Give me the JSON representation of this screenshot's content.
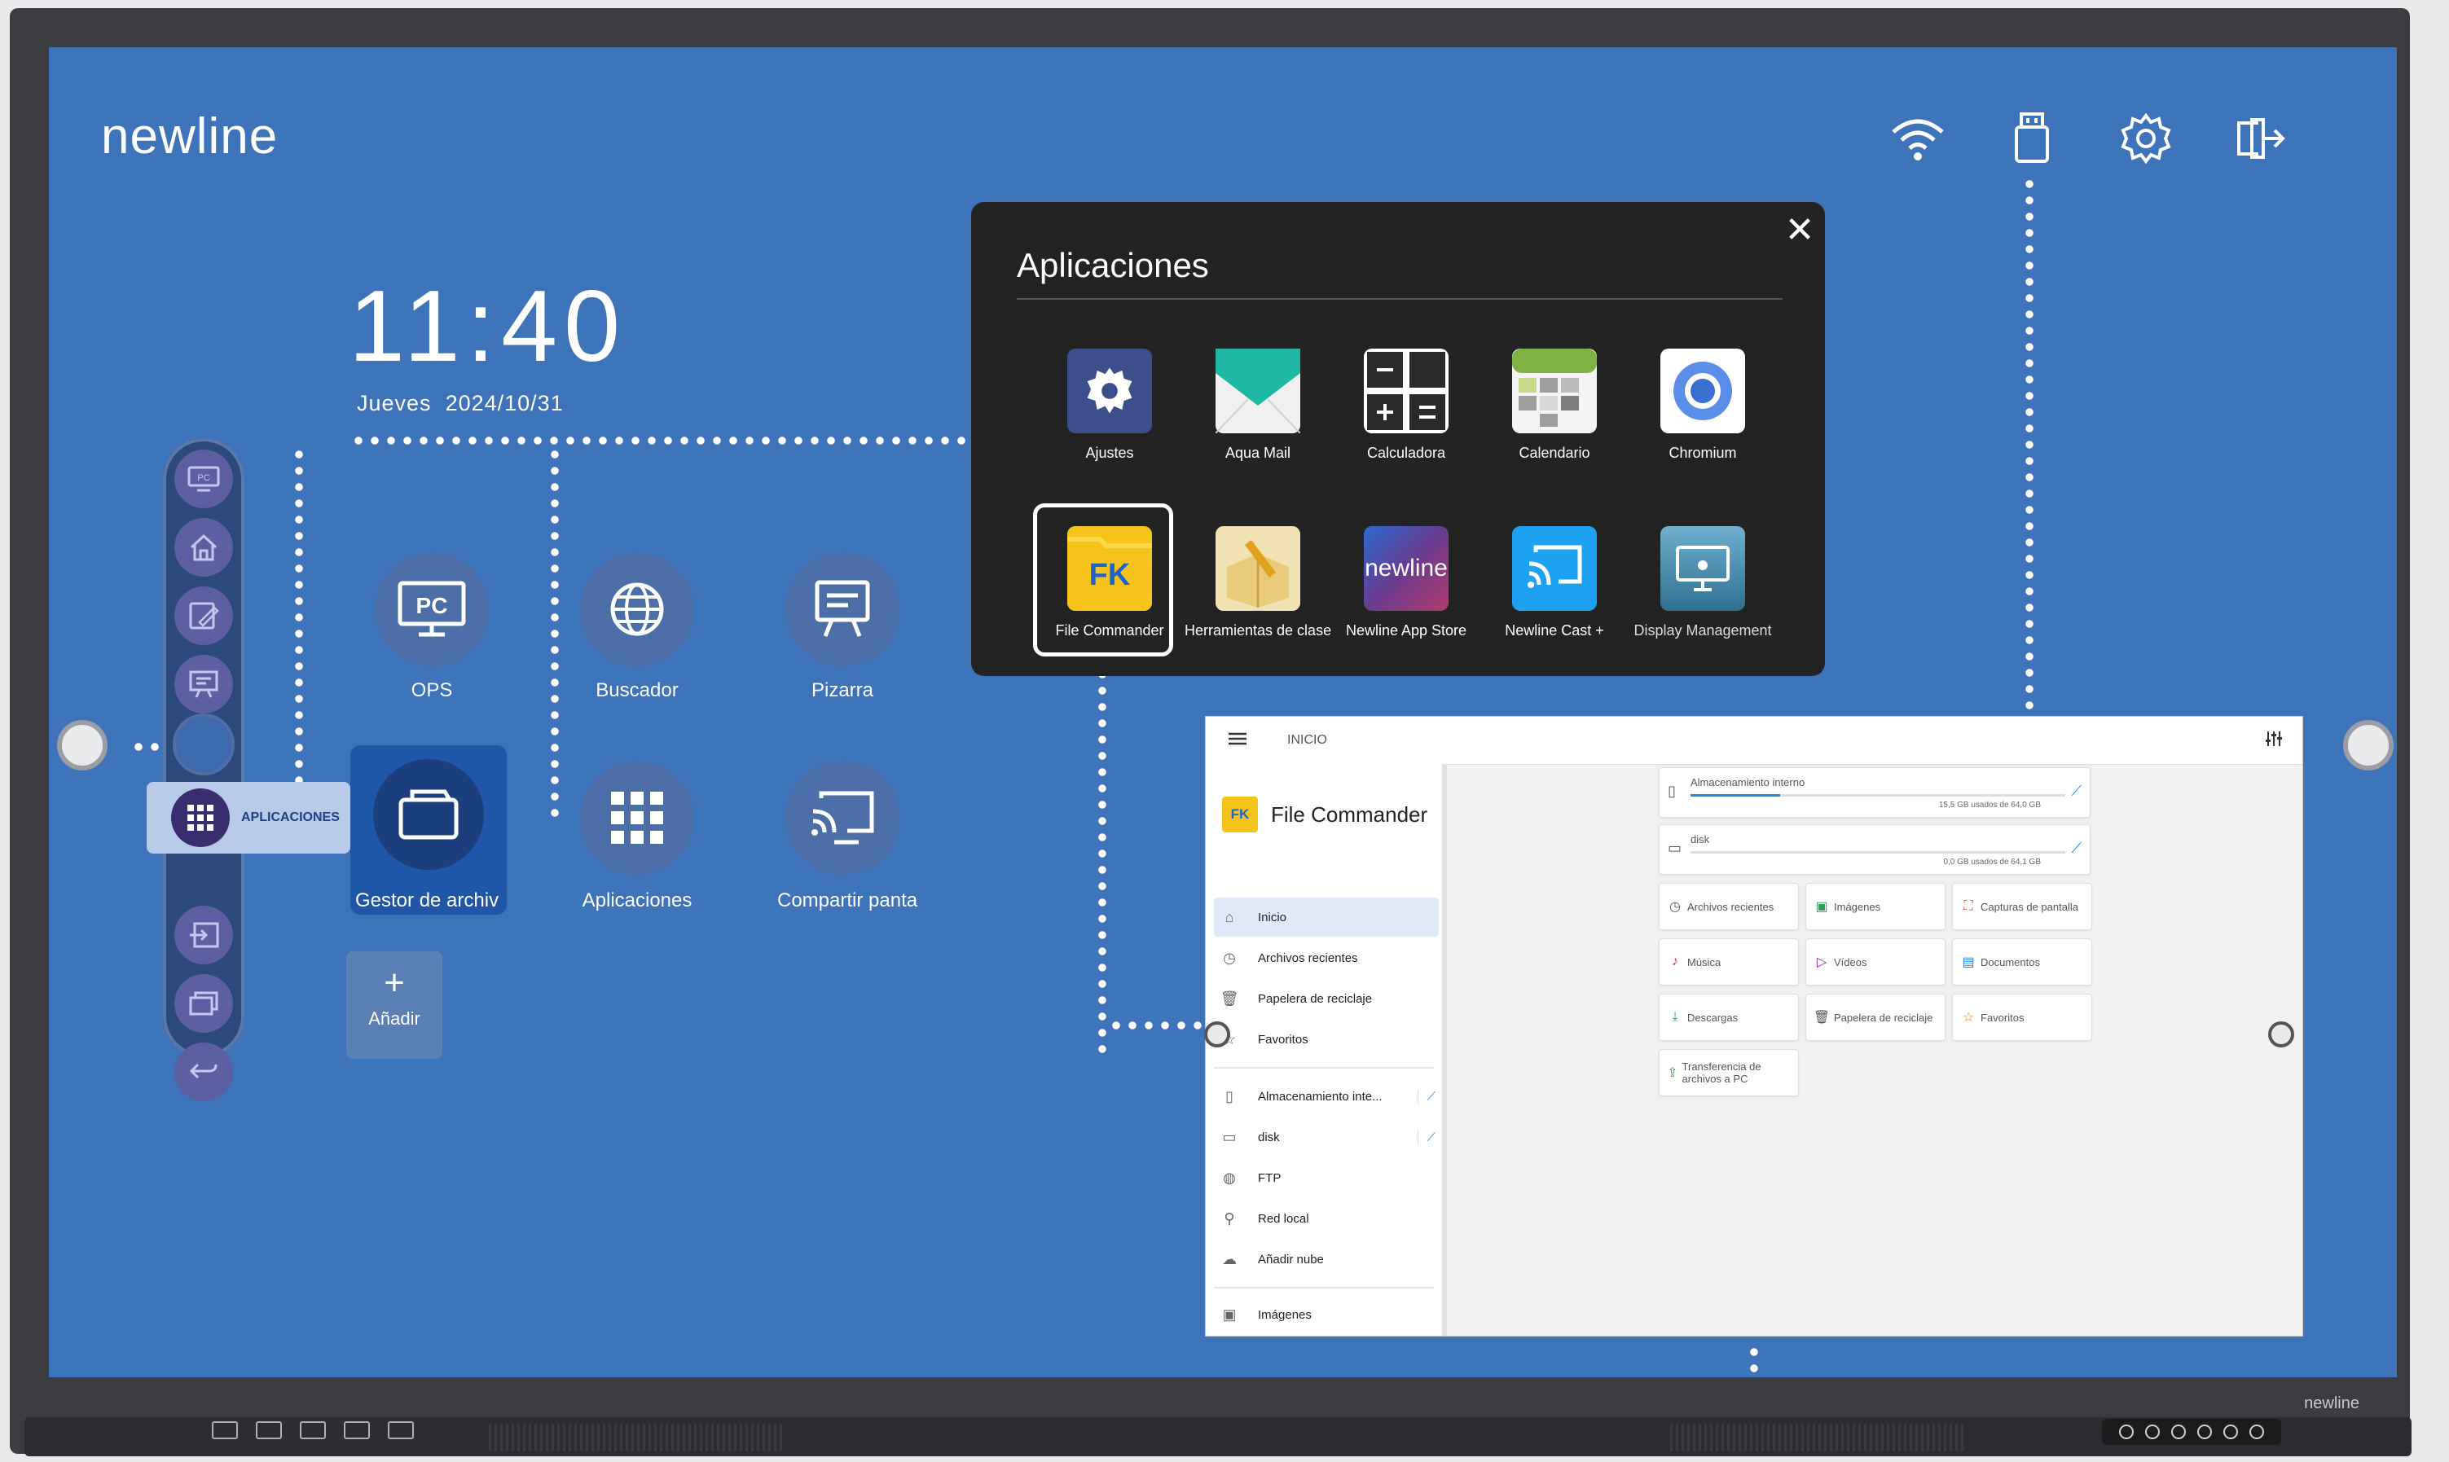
{
  "brand": {
    "logo": "newline",
    "bezel_label": "newline"
  },
  "status_icons": [
    "wifi-icon",
    "usb-icon",
    "gear-icon",
    "input-source-icon"
  ],
  "clock": {
    "time": "11:40",
    "day": "Jueves",
    "date": "2024/10/31"
  },
  "sidebar": {
    "items": [
      "pc-icon",
      "home-icon",
      "whiteboard-edit-icon",
      "presentation-icon",
      "ring-indicator",
      "apps-icon",
      "input-icon",
      "windows-icon",
      "back-icon"
    ],
    "active_label": "APLICACIONES"
  },
  "home_tiles": [
    {
      "label": "OPS",
      "icon": "pc-icon"
    },
    {
      "label": "Buscador",
      "icon": "globe-icon"
    },
    {
      "label": "Pizarra",
      "icon": "whiteboard-icon"
    },
    {
      "label": "Gestor de archiv",
      "icon": "folder-icon"
    },
    {
      "label": "Aplicaciones",
      "icon": "apps-grid-icon"
    },
    {
      "label": "Compartir panta",
      "icon": "screen-share-icon"
    }
  ],
  "add_button": {
    "symbol": "+",
    "label": "Añadir"
  },
  "apps_panel": {
    "title": "Aplicaciones",
    "close_symbol": "✕",
    "apps": [
      {
        "label": "Ajustes",
        "icon": "settings-gear-icon",
        "color": "#3c4f8a"
      },
      {
        "label": "Aqua Mail",
        "icon": "mail-envelope-icon",
        "color": "#1fb8a6"
      },
      {
        "label": "Calculadora",
        "icon": "calculator-icon",
        "color": "#2a2a2a"
      },
      {
        "label": "Calendario",
        "icon": "calendar-icon",
        "color": "#8bc34a"
      },
      {
        "label": "Chromium",
        "icon": "chromium-icon",
        "color": "#4a7fd6"
      },
      {
        "label": "File Commander",
        "icon": "file-commander-icon",
        "color": "#f6c21c",
        "badge": "FK"
      },
      {
        "label": "Herramientas de clase",
        "icon": "toolbox-icon",
        "color": "#e7c97a"
      },
      {
        "label": "Newline App Store",
        "icon": "newline-store-icon",
        "color": "#5a3f8c",
        "badge": "newline"
      },
      {
        "label": "Newline Cast +",
        "icon": "cast-icon",
        "color": "#1da1f2"
      },
      {
        "label": "Display Management",
        "icon": "display-management-icon",
        "color": "#4f8db3"
      }
    ]
  },
  "file_commander": {
    "header": "INICIO",
    "app_name": "File Commander",
    "app_badge": "FK",
    "nav": [
      {
        "label": "Inicio",
        "icon": "home-outline-icon",
        "active": true
      },
      {
        "label": "Archivos recientes",
        "icon": "clock-icon"
      },
      {
        "label": "Papelera de reciclaje",
        "icon": "trash-icon"
      },
      {
        "label": "Favoritos",
        "icon": "star-icon"
      }
    ],
    "storage_nav": [
      {
        "label": "Almacenamiento inte...",
        "icon": "phone-icon"
      },
      {
        "label": "disk",
        "icon": "sd-card-icon"
      },
      {
        "label": "FTP",
        "icon": "globe-icon"
      },
      {
        "label": "Red local",
        "icon": "network-icon"
      },
      {
        "label": "Añadir nube",
        "icon": "cloud-icon"
      }
    ],
    "last_nav": {
      "label": "Imágenes",
      "icon": "image-icon"
    },
    "storage_cards": [
      {
        "name": "Almacenamiento interno",
        "usage": "15,5 GB usados de 64,0 GB",
        "used_fraction": 0.24
      },
      {
        "name": "disk",
        "usage": "0,0 GB usados de 64,1 GB",
        "used_fraction": 0.0
      }
    ],
    "categories": [
      {
        "label": "Archivos recientes",
        "icon": "clock-icon",
        "color": "#555555"
      },
      {
        "label": "Imágenes",
        "icon": "image-icon",
        "color": "#2e9d5b"
      },
      {
        "label": "Capturas de pantalla",
        "icon": "screenshot-icon",
        "color": "#e2543b"
      },
      {
        "label": "Música",
        "icon": "music-icon",
        "color": "#d81b60"
      },
      {
        "label": "Vídeos",
        "icon": "video-icon",
        "color": "#8e24aa"
      },
      {
        "label": "Documentos",
        "icon": "document-icon",
        "color": "#1e88e5"
      },
      {
        "label": "Descargas",
        "icon": "download-icon",
        "color": "#26a69a"
      },
      {
        "label": "Papelera de reciclaje",
        "icon": "trash-icon",
        "color": "#555555"
      },
      {
        "label": "Favoritos",
        "icon": "star-icon",
        "color": "#f57c00"
      },
      {
        "label": "Transferencia de archivos a PC",
        "icon": "pc-transfer-icon",
        "color": "#43a047"
      }
    ]
  }
}
